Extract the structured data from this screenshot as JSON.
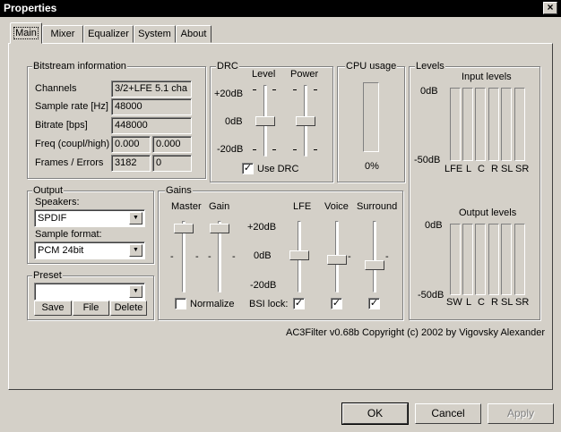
{
  "window": {
    "title": "Properties",
    "close": "×"
  },
  "tabs": [
    "Main",
    "Mixer",
    "Equalizer",
    "System",
    "About"
  ],
  "bitstream": {
    "title": "Bitstream information",
    "channels_label": "Channels",
    "channels_value": "3/2+LFE 5.1 cha",
    "sample_rate_label": "Sample rate [Hz]",
    "sample_rate_value": "48000",
    "bitrate_label": "Bitrate [bps]",
    "bitrate_value": "448000",
    "freq_label": "Freq (coupl/high)",
    "freq_coupl": "0.000",
    "freq_high": "0.000",
    "frames_label": "Frames / Errors",
    "frames_value": "3182",
    "errors_value": "0"
  },
  "drc": {
    "title": "DRC",
    "level_label": "Level",
    "power_label": "Power",
    "scale_top": "+20dB",
    "scale_mid": "0dB",
    "scale_bot": "-20dB",
    "use_drc_label": "Use DRC",
    "use_drc_checked": true,
    "level": 0.5,
    "power": 0.5
  },
  "cpu": {
    "title": "CPU usage",
    "value": "0%",
    "fraction": 0.0
  },
  "levels": {
    "title": "Levels",
    "input_title": "Input levels",
    "input_top": "0dB",
    "input_bottom": "-50dB",
    "input_channels": [
      "LFE",
      "L",
      "C",
      "R",
      "SL",
      "SR"
    ],
    "output_title": "Output levels",
    "output_top": "0dB",
    "output_bottom": "-50dB",
    "output_channels": [
      "SW",
      "L",
      "C",
      "R",
      "SL",
      "SR"
    ]
  },
  "output": {
    "title": "Output",
    "speakers_label": "Speakers:",
    "speakers_value": "SPDIF",
    "format_label": "Sample format:",
    "format_value": "PCM 24bit"
  },
  "preset": {
    "title": "Preset",
    "value": "",
    "save": "Save",
    "file": "File",
    "delete": "Delete"
  },
  "gains": {
    "title": "Gains",
    "master_label": "Master",
    "gain_label": "Gain",
    "lfe_label": "LFE",
    "voice_label": "Voice",
    "surround_label": "Surround",
    "scale_top": "+20dB",
    "scale_mid": "0dB",
    "scale_bot": "-20dB",
    "dash": "-",
    "normalize_label": "Normalize",
    "normalize_checked": false,
    "bsi_lock_label": "BSI lock:",
    "bsi_lock_checked": true,
    "voice_checked": true,
    "surround_checked": true,
    "master": 0.0,
    "gain": 0.0,
    "lfe": 0.5,
    "voice": 0.6,
    "surround": 0.7
  },
  "copyright": "AC3Filter v0.68b Copyright (c) 2002 by Vigovsky Alexander",
  "buttons": {
    "ok": "OK",
    "cancel": "Cancel",
    "apply": "Apply"
  }
}
